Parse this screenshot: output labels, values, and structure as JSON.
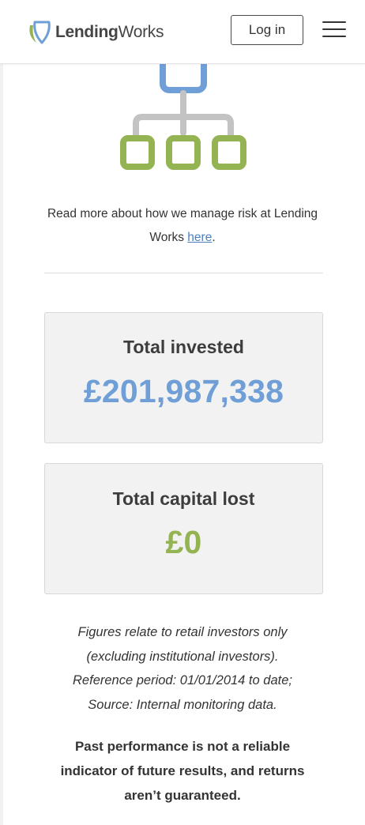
{
  "header": {
    "logo": {
      "part1": "Lending",
      "part2": "Works"
    },
    "login_label": "Log in",
    "menu_icon": "hamburger-menu-icon"
  },
  "diagram": {
    "icon": "risk-hierarchy-diagram-icon",
    "colors": {
      "top": "#6f9fd6",
      "lines": "#c3c3c3",
      "bottom": "#94b453"
    }
  },
  "risk_info": {
    "text": "Read more about how we manage risk at Lending Works",
    "link_label": "here",
    "trailing": "."
  },
  "stats": {
    "invested": {
      "label": "Total invested",
      "value": "£201,987,338",
      "color": "#6f9fd6"
    },
    "lost": {
      "label": "Total capital lost",
      "value": "£0",
      "color": "#94b453"
    }
  },
  "disclaimer": {
    "lines": [
      "Figures relate to retail investors only",
      "(excluding institutional investors).",
      "Reference period: 01/01/2014 to date;",
      "Source: Internal monitoring data."
    ]
  },
  "warning": {
    "lines": [
      "Past performance is not a reliable",
      "indicator of future results, and returns",
      "aren’t guaranteed."
    ]
  }
}
